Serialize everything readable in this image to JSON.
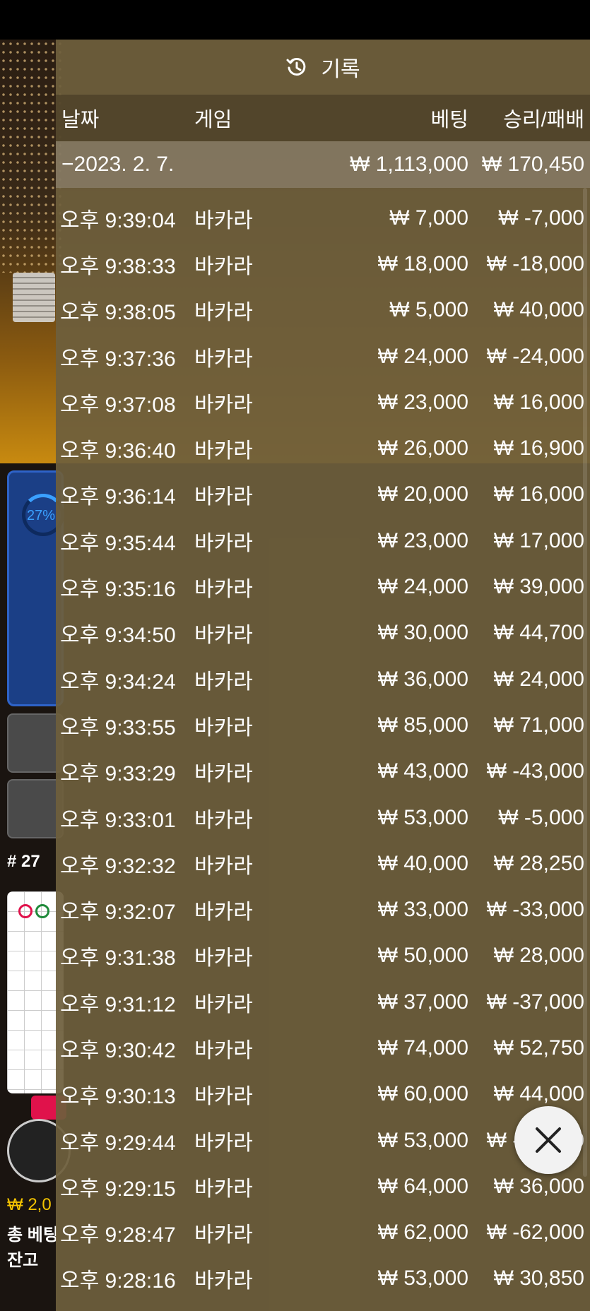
{
  "panel": {
    "title": "기록",
    "columns": {
      "date": "날짜",
      "game": "게임",
      "bet": "베팅",
      "winloss": "승리/패배"
    },
    "summary": {
      "date": "−2023. 2. 7.",
      "bet": "₩ 1,113,000",
      "winloss": "₩ 170,450"
    },
    "rows": [
      {
        "time": "오후 9:39:04",
        "game": "바카라",
        "bet": "₩ 7,000",
        "winloss": "₩ -7,000"
      },
      {
        "time": "오후 9:38:33",
        "game": "바카라",
        "bet": "₩ 18,000",
        "winloss": "₩ -18,000"
      },
      {
        "time": "오후 9:38:05",
        "game": "바카라",
        "bet": "₩ 5,000",
        "winloss": "₩ 40,000"
      },
      {
        "time": "오후 9:37:36",
        "game": "바카라",
        "bet": "₩ 24,000",
        "winloss": "₩ -24,000"
      },
      {
        "time": "오후 9:37:08",
        "game": "바카라",
        "bet": "₩ 23,000",
        "winloss": "₩ 16,000"
      },
      {
        "time": "오후 9:36:40",
        "game": "바카라",
        "bet": "₩ 26,000",
        "winloss": "₩ 16,900"
      },
      {
        "time": "오후 9:36:14",
        "game": "바카라",
        "bet": "₩ 20,000",
        "winloss": "₩ 16,000"
      },
      {
        "time": "오후 9:35:44",
        "game": "바카라",
        "bet": "₩ 23,000",
        "winloss": "₩ 17,000"
      },
      {
        "time": "오후 9:35:16",
        "game": "바카라",
        "bet": "₩ 24,000",
        "winloss": "₩ 39,000"
      },
      {
        "time": "오후 9:34:50",
        "game": "바카라",
        "bet": "₩ 30,000",
        "winloss": "₩ 44,700"
      },
      {
        "time": "오후 9:34:24",
        "game": "바카라",
        "bet": "₩ 36,000",
        "winloss": "₩ 24,000"
      },
      {
        "time": "오후 9:33:55",
        "game": "바카라",
        "bet": "₩ 85,000",
        "winloss": "₩ 71,000"
      },
      {
        "time": "오후 9:33:29",
        "game": "바카라",
        "bet": "₩ 43,000",
        "winloss": "₩ -43,000"
      },
      {
        "time": "오후 9:33:01",
        "game": "바카라",
        "bet": "₩ 53,000",
        "winloss": "₩ -5,000"
      },
      {
        "time": "오후 9:32:32",
        "game": "바카라",
        "bet": "₩ 40,000",
        "winloss": "₩ 28,250"
      },
      {
        "time": "오후 9:32:07",
        "game": "바카라",
        "bet": "₩ 33,000",
        "winloss": "₩ -33,000"
      },
      {
        "time": "오후 9:31:38",
        "game": "바카라",
        "bet": "₩ 50,000",
        "winloss": "₩ 28,000"
      },
      {
        "time": "오후 9:31:12",
        "game": "바카라",
        "bet": "₩ 37,000",
        "winloss": "₩ -37,000"
      },
      {
        "time": "오후 9:30:42",
        "game": "바카라",
        "bet": "₩ 74,000",
        "winloss": "₩ 52,750"
      },
      {
        "time": "오후 9:30:13",
        "game": "바카라",
        "bet": "₩ 60,000",
        "winloss": "₩ 44,000"
      },
      {
        "time": "오후 9:29:44",
        "game": "바카라",
        "bet": "₩ 53,000",
        "winloss": "₩ -53,000"
      },
      {
        "time": "오후 9:29:15",
        "game": "바카라",
        "bet": "₩ 64,000",
        "winloss": "₩ 36,000"
      },
      {
        "time": "오후 9:28:47",
        "game": "바카라",
        "bet": "₩ 62,000",
        "winloss": "₩ -62,000"
      },
      {
        "time": "오후 9:28:16",
        "game": "바카라",
        "bet": "₩ 53,000",
        "winloss": "₩ 30,850"
      }
    ]
  },
  "background": {
    "percent": "27%",
    "round_label": "# 27",
    "balance_amount": "₩ 2,0",
    "total_bet_label": "총 베팅",
    "balance_label": "잔고"
  },
  "icons": {
    "history": "history-icon",
    "close": "close-icon"
  },
  "colors": {
    "panel": "#6e5f3c",
    "text": "#ffffff",
    "accent_gold": "#f5c400",
    "blue": "#1b3f86"
  }
}
